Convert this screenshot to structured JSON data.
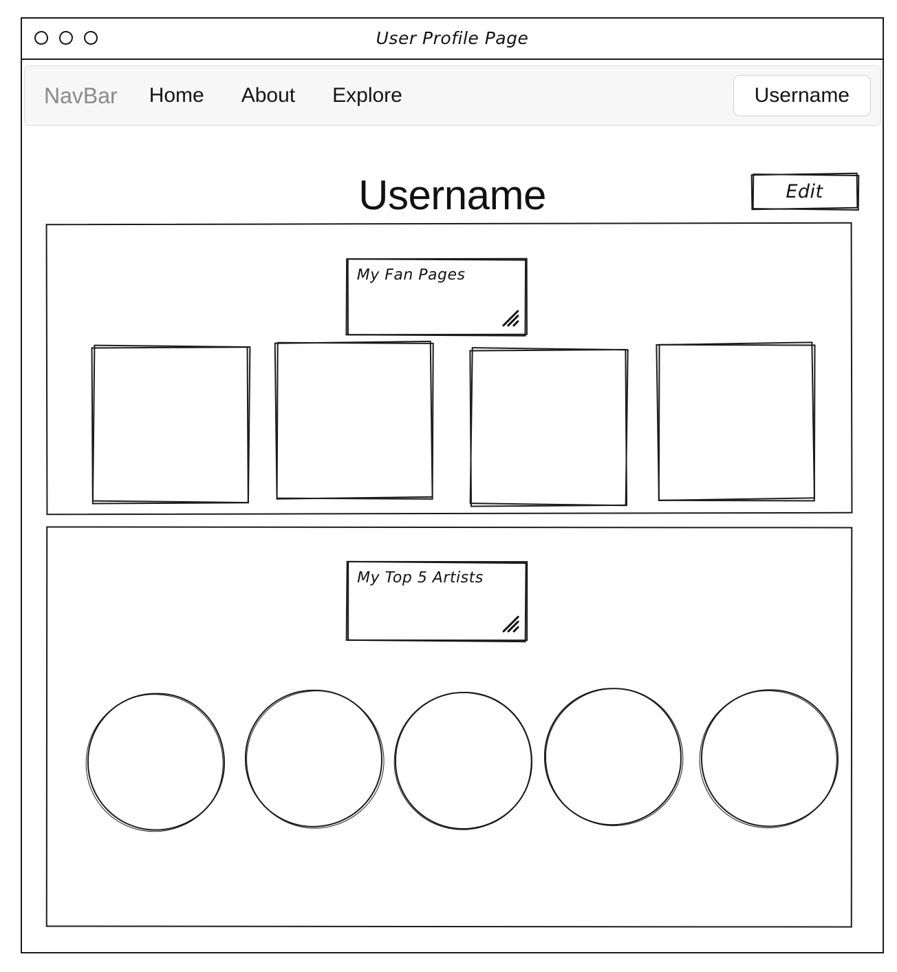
{
  "window": {
    "title": "User Profile Page",
    "controls": [
      "close-circle",
      "minimize-circle",
      "maximize-circle"
    ]
  },
  "navbar": {
    "brand": "NavBar",
    "links": [
      {
        "label": "Home"
      },
      {
        "label": "About"
      },
      {
        "label": "Explore"
      }
    ],
    "account_button": "Username"
  },
  "header": {
    "profile_name": "Username",
    "edit_button": "Edit"
  },
  "sections": [
    {
      "id": "fan-pages",
      "label": "My Fan Pages",
      "item_shape": "square",
      "items": [
        {
          "label": ""
        },
        {
          "label": ""
        },
        {
          "label": ""
        },
        {
          "label": ""
        }
      ]
    },
    {
      "id": "top-artists",
      "label": "My Top 5 Artists",
      "item_shape": "circle",
      "items": [
        {
          "label": ""
        },
        {
          "label": ""
        },
        {
          "label": ""
        },
        {
          "label": ""
        },
        {
          "label": ""
        }
      ]
    }
  ],
  "icons": {
    "resize_grip": "resize-grip-icon"
  },
  "colors": {
    "ink": "#1b1b1b",
    "navbar_background": "#f7f7f7",
    "navbar_border": "#dcdcdc",
    "brand_text": "#8a8a8a",
    "page_background": "#ffffff"
  }
}
